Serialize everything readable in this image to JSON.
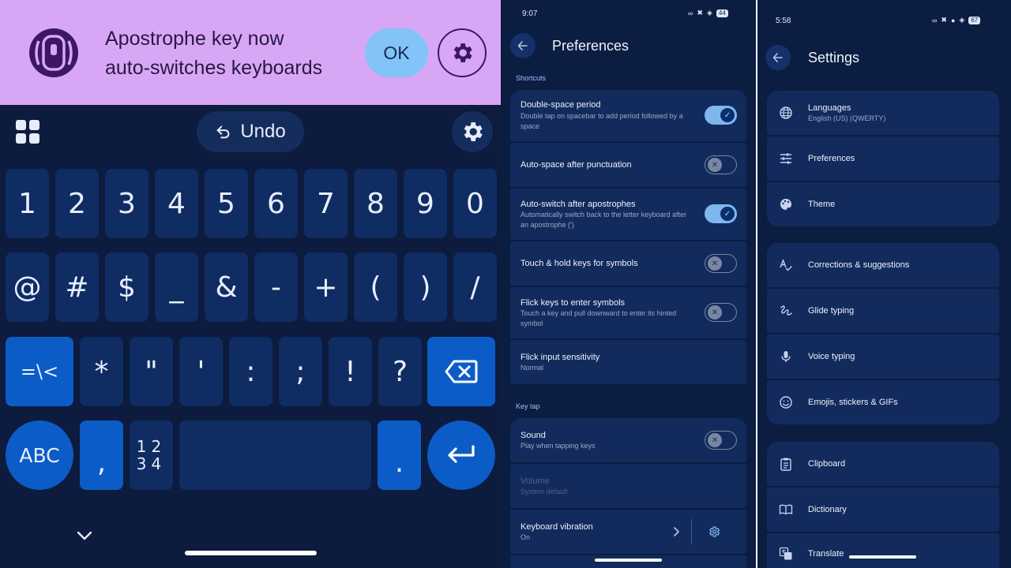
{
  "keyboard": {
    "banner": {
      "message_line1": "Apostrophe key now",
      "message_line2": "auto-switches keyboards",
      "ok_label": "OK"
    },
    "toolbar": {
      "undo_label": "Undo"
    },
    "rows": {
      "numbers": [
        "1",
        "2",
        "3",
        "4",
        "5",
        "6",
        "7",
        "8",
        "9",
        "0"
      ],
      "symbols1": [
        "@",
        "#",
        "$",
        "_",
        "&",
        "-",
        "+",
        "(",
        ")",
        "/"
      ],
      "symbols2": [
        "*",
        "\"",
        "'",
        ":",
        ";",
        "!",
        "?"
      ],
      "more_symbols_label": "=\\<",
      "abc_label": "ABC",
      "comma": ",",
      "numpad_top": "12",
      "numpad_bottom": "34",
      "period": "."
    },
    "colors": {
      "banner_bg": "#d7a7f5",
      "accent_key": "#0b5cc7",
      "key_bg": "#0f2c63"
    }
  },
  "preferences": {
    "status_time": "9:07",
    "battery": "44",
    "title": "Preferences",
    "sections": {
      "shortcuts": "Shortcuts",
      "key_tap": "Key tap"
    },
    "items": {
      "double_space": {
        "title": "Double-space period",
        "subtitle": "Double tap on spacebar to add period followed by a space",
        "on": true
      },
      "auto_space": {
        "title": "Auto-space after punctuation",
        "on": false
      },
      "auto_switch": {
        "title": "Auto-switch after apostrophes",
        "subtitle": "Automatically switch back to the letter keyboard after an apostrophe (')",
        "on": true
      },
      "touch_hold": {
        "title": "Touch & hold keys for symbols",
        "on": false
      },
      "flick_keys": {
        "title": "Flick keys to enter symbols",
        "subtitle": "Touch a key and pull downward to enter its hinted symbol",
        "on": false
      },
      "flick_sensitivity": {
        "title": "Flick input sensitivity",
        "subtitle": "Normal"
      },
      "sound": {
        "title": "Sound",
        "subtitle": "Play when tapping keys",
        "on": false
      },
      "volume": {
        "title": "Volume",
        "subtitle": "System default",
        "disabled": true
      },
      "vibration": {
        "title": "Keyboard vibration",
        "subtitle": "On"
      }
    },
    "colors": {
      "switch_on": "#7fb6ee",
      "section_label": "#9fc2ff",
      "row_bg": "#122b5c"
    }
  },
  "settings": {
    "status_time": "5:58",
    "battery": "67",
    "title": "Settings",
    "items": {
      "languages": {
        "title": "Languages",
        "subtitle": "English (US) (QWERTY)",
        "icon": "globe-icon"
      },
      "preferences": {
        "title": "Preferences",
        "icon": "sliders-icon"
      },
      "theme": {
        "title": "Theme",
        "icon": "palette-icon"
      },
      "corrections": {
        "title": "Corrections & suggestions",
        "icon": "spellcheck-icon"
      },
      "glide": {
        "title": "Glide typing",
        "icon": "gesture-icon"
      },
      "voice": {
        "title": "Voice typing",
        "icon": "mic-icon"
      },
      "emojis": {
        "title": "Emojis, stickers & GIFs",
        "icon": "emoji-icon"
      },
      "clipboard": {
        "title": "Clipboard",
        "icon": "clipboard-icon"
      },
      "dictionary": {
        "title": "Dictionary",
        "icon": "book-icon"
      },
      "translate": {
        "title": "Translate",
        "icon": "translate-icon"
      }
    }
  }
}
